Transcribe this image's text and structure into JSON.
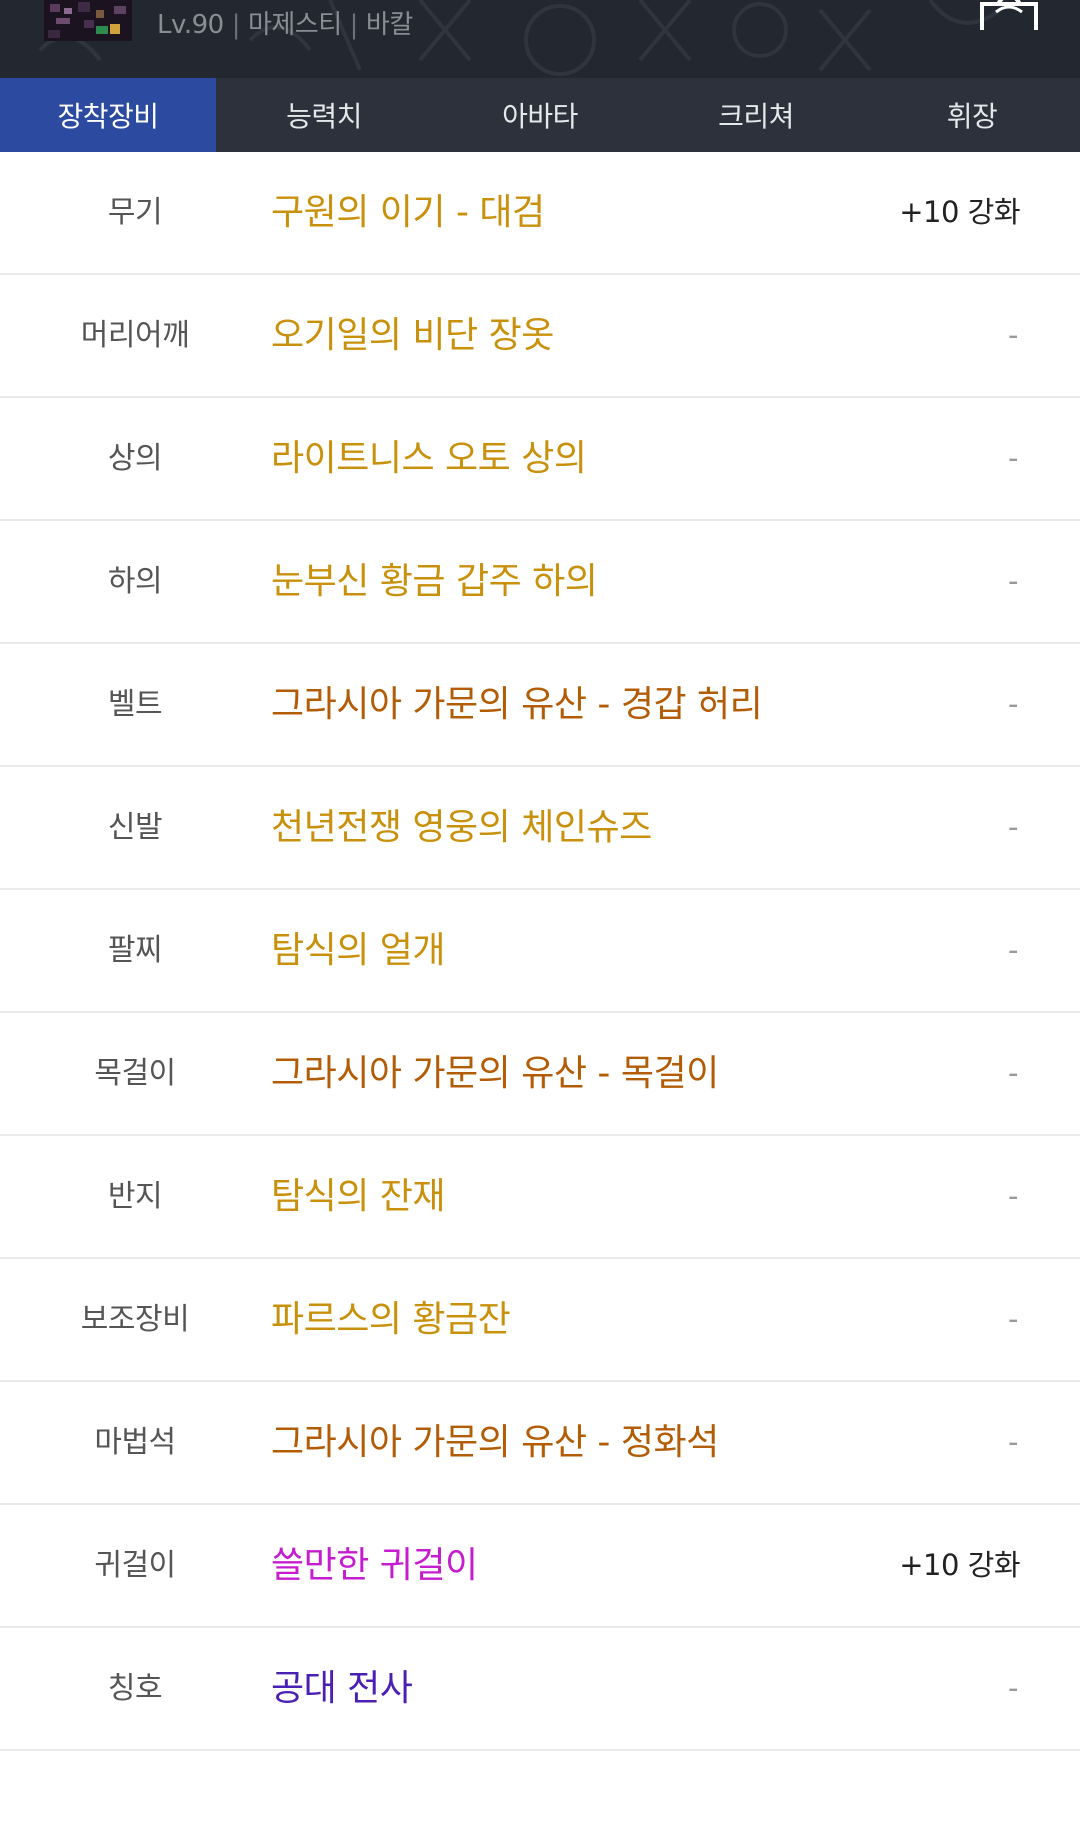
{
  "header": {
    "level": "Lv.90",
    "job": "마제스티",
    "server": "바칼",
    "separator": "|"
  },
  "tabs": [
    {
      "label": "장착장비",
      "active": true
    },
    {
      "label": "능력치",
      "active": false
    },
    {
      "label": "아바타",
      "active": false
    },
    {
      "label": "크리쳐",
      "active": false
    },
    {
      "label": "휘장",
      "active": false
    }
  ],
  "colors": {
    "unique": "#c9900b",
    "legendary": "#b25c06",
    "rare": "#c51ccf",
    "title": "#4a1fb3",
    "tab_active": "#2b4aa0"
  },
  "equipment": [
    {
      "slot": "무기",
      "name": "구원의 이기 - 대검",
      "rarity": "unique",
      "upgrade": "+10 강화"
    },
    {
      "slot": "머리어깨",
      "name": "오기일의 비단 장옷",
      "rarity": "unique",
      "upgrade": "-"
    },
    {
      "slot": "상의",
      "name": "라이트니스 오토 상의",
      "rarity": "unique",
      "upgrade": "-"
    },
    {
      "slot": "하의",
      "name": "눈부신 황금 갑주 하의",
      "rarity": "unique",
      "upgrade": "-"
    },
    {
      "slot": "벨트",
      "name": "그라시아 가문의 유산 - 경갑 허리",
      "rarity": "legendary",
      "upgrade": "-"
    },
    {
      "slot": "신발",
      "name": "천년전쟁 영웅의 체인슈즈",
      "rarity": "unique",
      "upgrade": "-"
    },
    {
      "slot": "팔찌",
      "name": "탐식의 얼개",
      "rarity": "unique",
      "upgrade": "-"
    },
    {
      "slot": "목걸이",
      "name": "그라시아 가문의 유산 - 목걸이",
      "rarity": "legendary",
      "upgrade": "-"
    },
    {
      "slot": "반지",
      "name": "탐식의 잔재",
      "rarity": "unique",
      "upgrade": "-"
    },
    {
      "slot": "보조장비",
      "name": "파르스의 황금잔",
      "rarity": "unique",
      "upgrade": "-"
    },
    {
      "slot": "마법석",
      "name": "그라시아 가문의 유산 - 정화석",
      "rarity": "legendary",
      "upgrade": "-"
    },
    {
      "slot": "귀걸이",
      "name": "쓸만한 귀걸이",
      "rarity": "rare",
      "upgrade": "+10 강화"
    },
    {
      "slot": "칭호",
      "name": "공대 전사",
      "rarity": "title",
      "upgrade": "-"
    }
  ]
}
